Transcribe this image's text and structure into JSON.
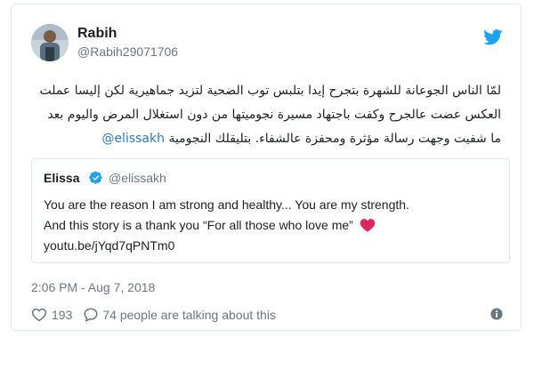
{
  "author": {
    "name": "Rabih",
    "handle": "@Rabih29071706"
  },
  "tweet": {
    "text_line1": "لمّا الناس الجوعانة للشهرة بتجرح إيدا بتلبس توب الضحية لتزيد جماهيرية لكن إليسا عملت",
    "text_line2": "العكس عضت عالجرح وكفت باجتهاد مسيرة نجوميتها من دون استغلال المرض واليوم بعد",
    "text_line3": "ما شفيت وجهت رسالة مؤثرة ومحفزة عالشفاء. بتليقلك النجومية",
    "mention": "@elissakh"
  },
  "quoted": {
    "name": "Elissa",
    "handle": "@elissakh",
    "line1": "You are the reason I am strong and healthy... You are my strength.",
    "line2": "And this story is a thank you “For all those who love me”",
    "link": "youtu.be/jYqd7qPNTm0",
    "verified_icon": "verified-badge-icon",
    "heart_icon": "red-heart-icon",
    "heart_color": "#e0245e"
  },
  "timestamp": "2:06 PM - Aug 7, 2018",
  "actions": {
    "likes": "193",
    "replies_text": "74 people are talking about this",
    "like_icon": "heart-outline-icon",
    "reply_icon": "reply-bubble-icon",
    "info_icon": "info-icon"
  },
  "colors": {
    "twitter_blue": "#1da1f2",
    "link_blue": "#2b7bb9",
    "muted": "#697882",
    "border": "#e1e8ed"
  }
}
